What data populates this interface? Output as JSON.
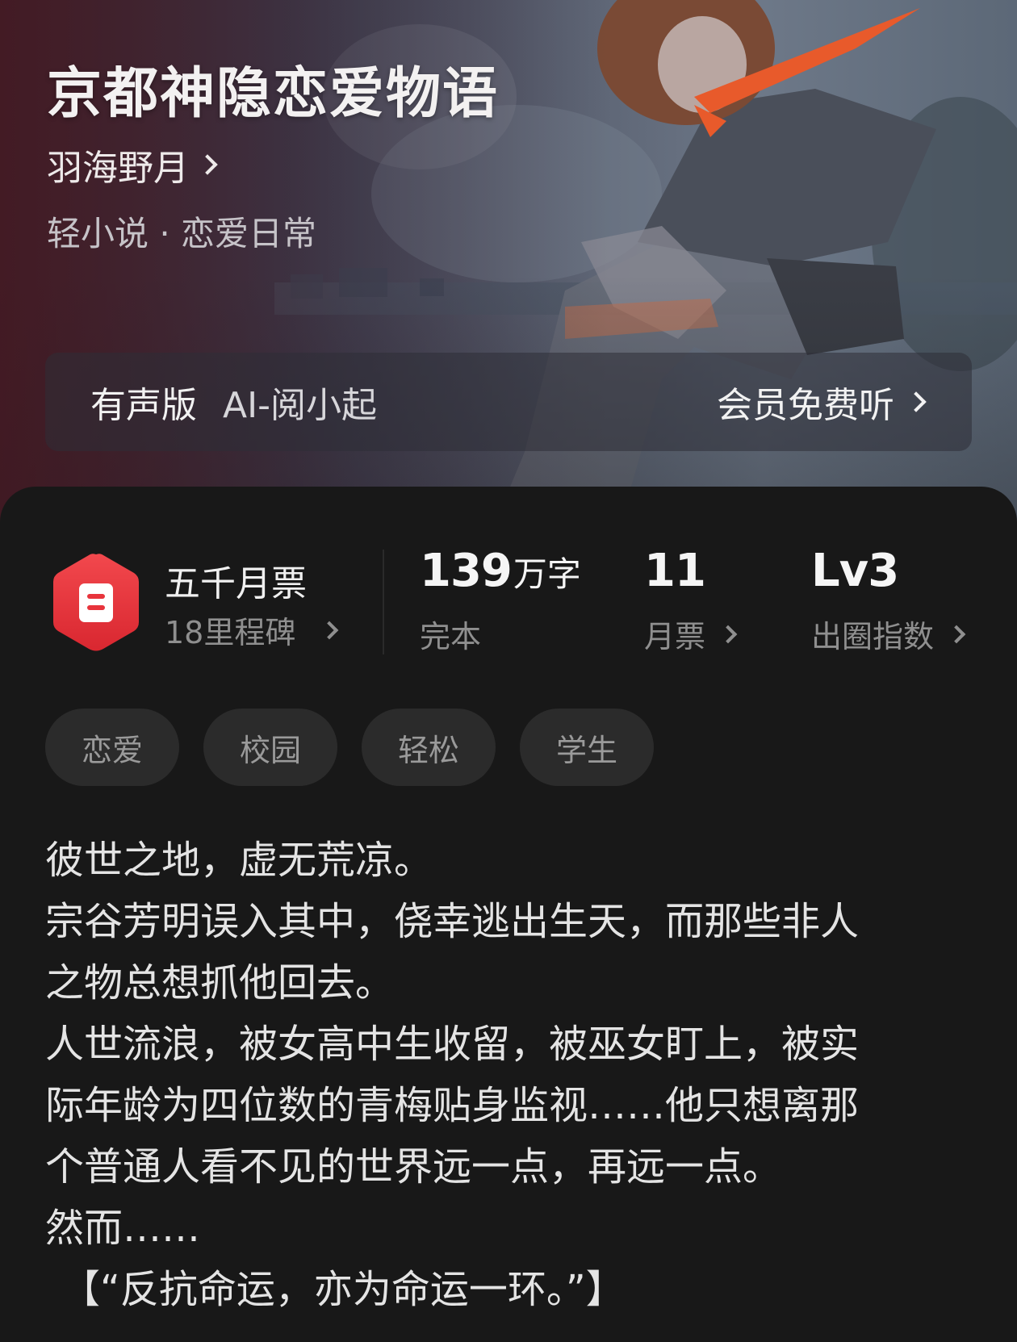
{
  "book": {
    "title": "京都神隐恋爱物语",
    "author": "羽海野月",
    "category": "轻小说 · 恋爱日常"
  },
  "audio": {
    "title": "有声版",
    "narrator": "AI-阅小起",
    "action": "会员免费听"
  },
  "stats": {
    "award_title": "五千月票",
    "award_sub": "18里程碑",
    "words_value": "139",
    "words_unit": "万字",
    "words_label": "完本",
    "votes_value": "11",
    "votes_label": "月票",
    "level_value": "Lv3",
    "level_label": "出圈指数"
  },
  "tags": [
    "恋爱",
    "校园",
    "轻松",
    "学生"
  ],
  "synopsis": [
    "彼世之地，虚无荒凉。",
    "宗谷芳明误入其中，侥幸逃出生天，而那些非人",
    "之物总想抓他回去。",
    "人世流浪，被女高中生收留，被巫女盯上，被实",
    "际年龄为四位数的青梅贴身监视……他只想离那",
    "个普通人看不见的世界远一点，再远一点。",
    "然而……",
    "【“反抗命运，亦为命运一环。”】"
  ],
  "colors": {
    "badge_red": "#e8343c",
    "card_bg": "#181818",
    "tag_bg": "#2b2b2b"
  }
}
